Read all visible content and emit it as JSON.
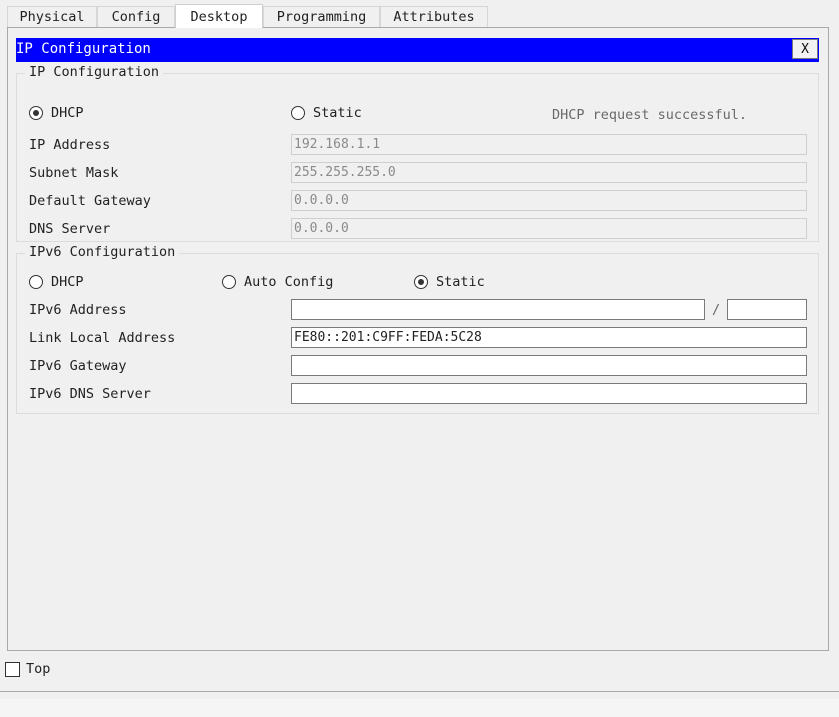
{
  "tabs": [
    {
      "label": "Physical"
    },
    {
      "label": "Config"
    },
    {
      "label": "Desktop"
    },
    {
      "label": "Programming"
    },
    {
      "label": "Attributes"
    }
  ],
  "active_tab": "Desktop",
  "window": {
    "title": "IP Configuration",
    "close_label": "X"
  },
  "ipv4": {
    "legend": "IP Configuration",
    "dhcp_label": "DHCP",
    "static_label": "Static",
    "selected": "DHCP",
    "status_message": "DHCP request successful.",
    "ip_address_label": "IP Address",
    "ip_address_value": "192.168.1.1",
    "subnet_mask_label": "Subnet Mask",
    "subnet_mask_value": "255.255.255.0",
    "default_gateway_label": "Default Gateway",
    "default_gateway_value": "0.0.0.0",
    "dns_server_label": "DNS Server",
    "dns_server_value": "0.0.0.0"
  },
  "ipv6": {
    "legend": "IPv6 Configuration",
    "dhcp_label": "DHCP",
    "auto_config_label": "Auto Config",
    "static_label": "Static",
    "selected": "Static",
    "ipv6_address_label": "IPv6 Address",
    "ipv6_address_value": "",
    "prefix_separator": "/",
    "prefix_value": "",
    "link_local_label": "Link Local Address",
    "link_local_value": "FE80::201:C9FF:FEDA:5C28",
    "ipv6_gateway_label": "IPv6 Gateway",
    "ipv6_gateway_value": "",
    "ipv6_dns_label": "IPv6 DNS Server",
    "ipv6_dns_value": ""
  },
  "footer": {
    "top_label": "Top",
    "top_checked": false
  }
}
